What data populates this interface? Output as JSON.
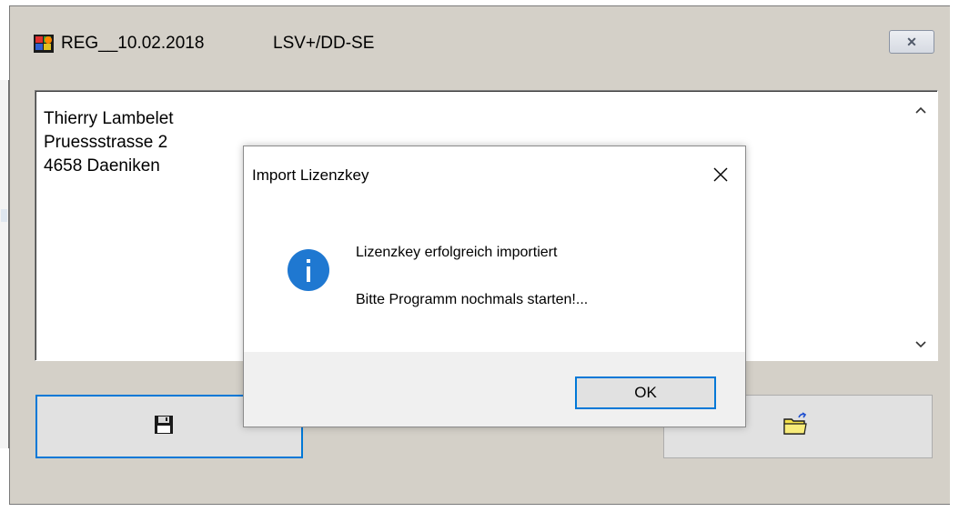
{
  "window": {
    "title": "REG__10.02.2018",
    "subtitle": "LSV+/DD-SE",
    "close_glyph": "✕"
  },
  "address": {
    "lines": [
      "Thierry Lambelet",
      "Pruessstrasse 2",
      "4658 Daeniken"
    ]
  },
  "dialog": {
    "title": "Import Lizenzkey",
    "message_line1": "Lizenzkey erfolgreich importiert",
    "message_line2": "Bitte Programm nochmals starten!...",
    "ok_label": "OK",
    "icon": "info-icon"
  },
  "toolbar": {
    "save_icon": "floppy-disk-icon",
    "open_icon": "folder-open-icon"
  },
  "colors": {
    "accent": "#0078d7",
    "window_bg": "#d4d0c8",
    "dialog_footer": "#f0f0f0"
  }
}
